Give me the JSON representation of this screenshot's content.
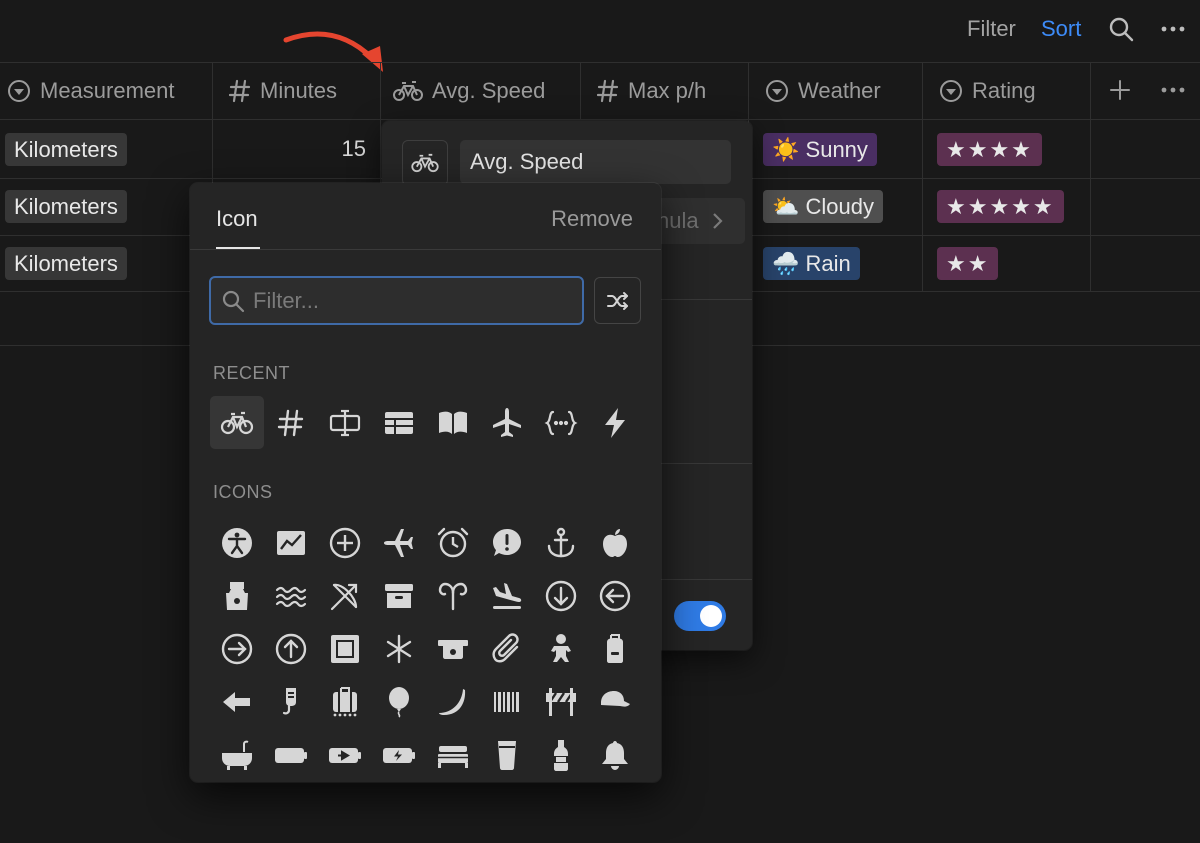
{
  "toolbar": {
    "filter": "Filter",
    "sort": "Sort"
  },
  "columns": [
    {
      "label": "Measurement",
      "icon": "select-circle-icon"
    },
    {
      "label": "Minutes",
      "icon": "hash-icon"
    },
    {
      "label": "Avg. Speed",
      "icon": "bicycle-icon"
    },
    {
      "label": "Max p/h",
      "icon": "hash-icon"
    },
    {
      "label": "Weather",
      "icon": "select-circle-icon"
    },
    {
      "label": "Rating",
      "icon": "select-circle-icon"
    }
  ],
  "rows": [
    {
      "measurement": "Kilometers",
      "minutes": "15",
      "weather_icon": "☀️",
      "weather": "Sunny",
      "rating": "★★★★"
    },
    {
      "measurement": "Kilometers",
      "minutes": "",
      "weather_icon": "⛅",
      "weather": "Cloudy",
      "rating": "★★★★★"
    },
    {
      "measurement": "Kilometers",
      "minutes": "",
      "weather_icon": "🌧️",
      "weather": "Rain",
      "rating": "★★"
    }
  ],
  "property_panel": {
    "name_value": "Avg. Speed",
    "type_label_partial": "nula",
    "toggle_on": true
  },
  "icon_picker": {
    "tab_label": "Icon",
    "remove_label": "Remove",
    "filter_placeholder": "Filter...",
    "recent_label": "RECENT",
    "icons_label": "ICONS",
    "recent": [
      "bicycle-icon",
      "hash-icon",
      "text-cursor-icon",
      "table-icon",
      "book-icon",
      "airplane-icon",
      "code-braces-icon",
      "lightning-icon"
    ],
    "icons": [
      "accessibility-icon",
      "chart-line-icon",
      "plus-circle-icon",
      "airplane-icon",
      "alarm-clock-icon",
      "alert-bubble-icon",
      "anchor-icon",
      "apple-icon",
      "apron-icon",
      "waves-icon",
      "archery-icon",
      "archive-box-icon",
      "aries-icon",
      "airplane-landing-icon",
      "arrow-down-circle-icon",
      "arrow-left-circle-icon",
      "arrow-right-circle-icon",
      "arrow-up-circle-icon",
      "picture-frame-icon",
      "asterisk-icon",
      "atm-icon",
      "paperclip-icon",
      "baby-icon",
      "backpack-icon",
      "arrow-left-icon",
      "baby-bottle-icon",
      "luggage-icon",
      "balloon-icon",
      "banana-icon",
      "barcode-icon",
      "barrier-icon",
      "baseball-cap-icon",
      "bathtub-icon",
      "battery-icon",
      "battery-charging-icon",
      "battery-bolt-icon",
      "bed-icon",
      "beer-glass-icon",
      "beer-bottle-icon",
      "bell-icon"
    ]
  }
}
